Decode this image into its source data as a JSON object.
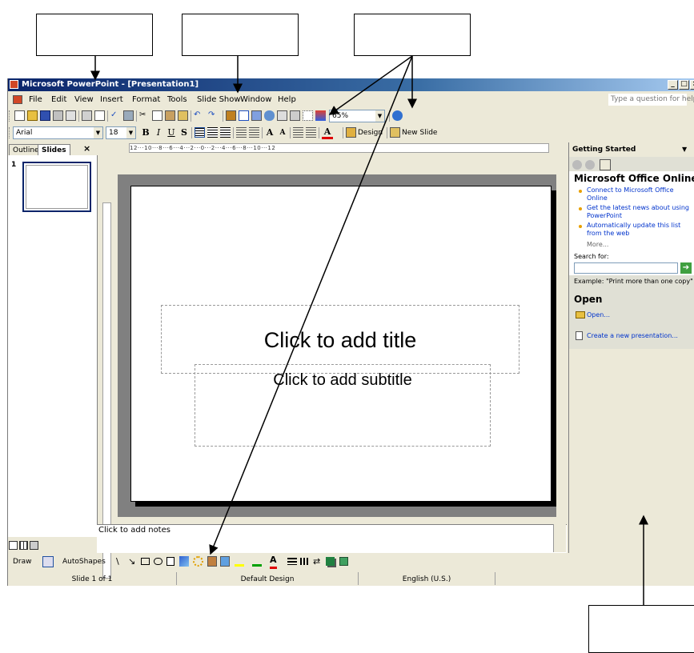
{
  "window": {
    "title": "Microsoft PowerPoint - [Presentation1]",
    "controls": [
      "_",
      "□",
      "×"
    ]
  },
  "menu": {
    "items": [
      {
        "label": "File",
        "hotkey": "F"
      },
      {
        "label": "Edit",
        "hotkey": "E"
      },
      {
        "label": "View",
        "hotkey": "V"
      },
      {
        "label": "Insert",
        "hotkey": "I"
      },
      {
        "label": "Format",
        "hotkey": "o"
      },
      {
        "label": "Tools",
        "hotkey": "T"
      },
      {
        "label": "Slide Show",
        "hotkey": "d"
      },
      {
        "label": "Window",
        "hotkey": "W"
      },
      {
        "label": "Help",
        "hotkey": "H"
      }
    ],
    "help_placeholder": "Type a question for help"
  },
  "standard_toolbar": {
    "zoom": "65%"
  },
  "formatting_toolbar": {
    "font": "Arial",
    "size": "18",
    "design_label": "Design",
    "new_slide_label": "New Slide"
  },
  "left_panel": {
    "tab_outline": "Outline",
    "tab_slides": "Slides",
    "close": "×",
    "slide_number": "1"
  },
  "ruler": {
    "h_text": "12···10···8···6···4···2···0···2···4···6···8···10···12"
  },
  "slide": {
    "title_placeholder": "Click to add title",
    "subtitle_placeholder": "Click to add subtitle"
  },
  "notes": {
    "placeholder": "Click to add notes"
  },
  "drawing_toolbar": {
    "draw_label": "Draw",
    "autoshapes_label": "AutoShapes"
  },
  "status": {
    "slide": "Slide 1 of 1",
    "design": "Default Design",
    "language": "English (U.S.)"
  },
  "task_pane": {
    "title": "Getting Started",
    "section_online": "Microsoft Office Online",
    "links": [
      "Connect to Microsoft Office Online",
      "Get the latest news about using PowerPoint",
      "Automatically update this list from the web"
    ],
    "more": "More...",
    "search_label": "Search for:",
    "example": "Example:  \"Print more than one copy\"",
    "section_open": "Open",
    "open_link": "Open...",
    "create_link": "Create a new presentation..."
  },
  "colors": {
    "title_gradient_start": "#0a246a",
    "title_gradient_end": "#a6caf0",
    "chrome": "#ece9d8",
    "workspace": "#808080",
    "link": "#0033cc"
  }
}
